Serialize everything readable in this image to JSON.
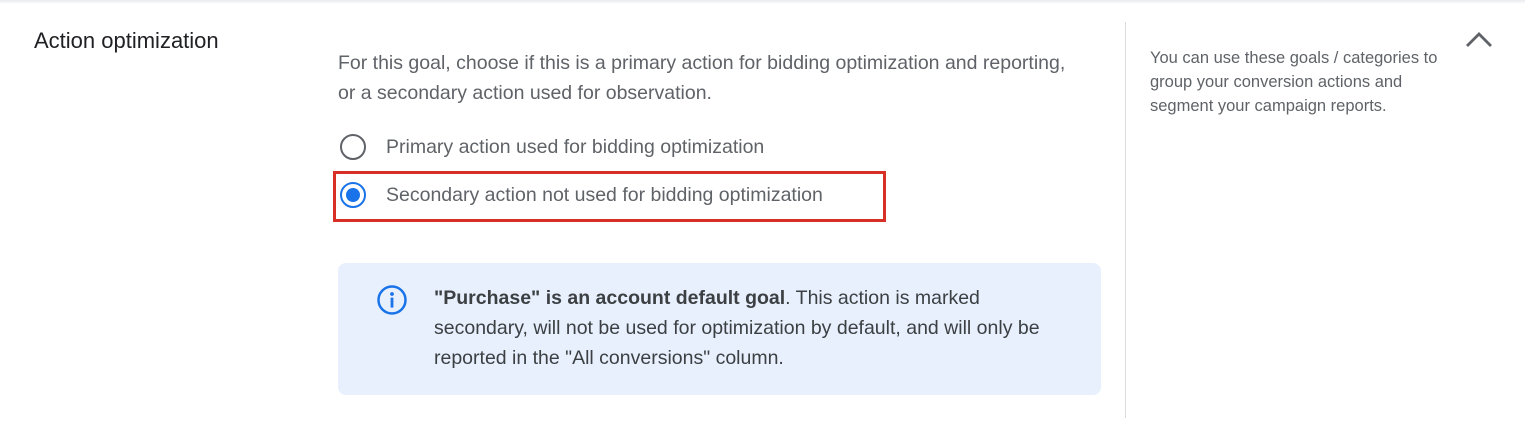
{
  "section": {
    "title": "Action optimization"
  },
  "main": {
    "description": "For this goal, choose if this is a primary action for bidding optimization and reporting, or a secondary action used for observation.",
    "options": [
      {
        "label": "Primary action used for bidding optimization",
        "selected": false
      },
      {
        "label": "Secondary action not used for bidding optimization",
        "selected": true
      }
    ],
    "info": {
      "icon": "info-icon",
      "bold": "\"Purchase\" is an account default goal",
      "text": ". This action is marked secondary, will not be used for optimization by default, and will only be reported in the \"All conversions\" column."
    }
  },
  "help": {
    "text": "You can use these goals / categories to group your conversion actions and segment your campaign reports."
  },
  "controls": {
    "collapse_icon": "chevron-up-icon"
  },
  "colors": {
    "accent": "#1a73e8",
    "highlight": "#d93025",
    "info_background": "#e8f0fe"
  }
}
